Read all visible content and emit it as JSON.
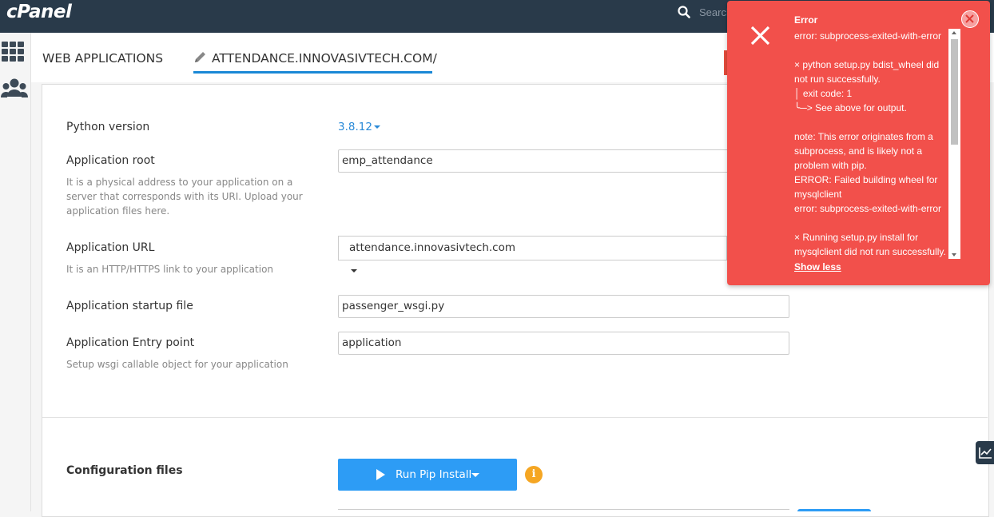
{
  "topbar": {
    "logo": "cPanel",
    "search_placeholder": "Search"
  },
  "tabs": {
    "web_applications": "WEB APPLICATIONS",
    "current_app": "ATTENDANCE.INNOVASIVTECH.COM/"
  },
  "form": {
    "python_version_label": "Python version",
    "python_version_value": "3.8.12",
    "app_root_label": "Application root",
    "app_root_value": "emp_attendance",
    "app_root_help": "It is a physical address to your application on a server that corresponds with its URI. Upload your application files here.",
    "app_url_label": "Application URL",
    "app_url_domain": "attendance.innovasivtech.com",
    "app_url_path": "",
    "app_url_help": "It is an HTTP/HTTPS link to your application",
    "startup_file_label": "Application startup file",
    "startup_file_value": "passenger_wsgi.py",
    "entry_point_label": "Application Entry point",
    "entry_point_value": "application",
    "entry_point_help": "Setup wsgi callable object for your application"
  },
  "config": {
    "section_title": "Configuration files",
    "run_pip_label": "Run Pip Install",
    "info_glyph": "i"
  },
  "toast": {
    "title": "Error",
    "lines": [
      "error: subprocess-exited-with-error",
      "",
      "× python setup.py bdist_wheel did not run successfully.",
      "│ exit code: 1",
      "╰─> See above for output.",
      "",
      "note: This error originates from a subprocess, and is likely not a problem with pip.",
      "ERROR: Failed building wheel for mysqlclient",
      "error: subprocess-exited-with-error",
      "",
      "× Running setup.py install for mysqlclient did not run successfully."
    ],
    "show_less": "Show less",
    "color": "#f2504b"
  },
  "colors": {
    "topbar": "#293a4a",
    "accent": "#2d9cf5",
    "link": "#2a8ad8",
    "warning": "#f5a623"
  }
}
